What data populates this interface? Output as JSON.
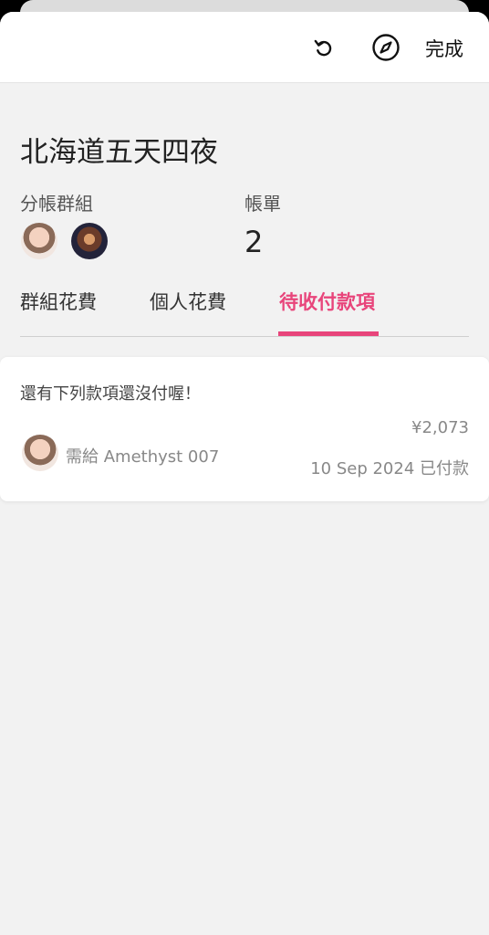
{
  "header": {
    "refresh_icon": "refresh-icon",
    "compass_icon": "compass-icon",
    "done_label": "完成"
  },
  "trip": {
    "title": "北海道五天四夜",
    "group_label": "分帳群組",
    "bills_label": "帳單",
    "bills_count": "2"
  },
  "tabs": [
    {
      "label": "群組花費"
    },
    {
      "label": "個人花費"
    },
    {
      "label": "待收付款項",
      "active": true
    }
  ],
  "pending": {
    "message": "還有下列款項還沒付喔！",
    "items": [
      {
        "text": "需給 Amethyst 007",
        "amount": "¥2,073",
        "status": "10 Sep 2024 已付款"
      }
    ]
  },
  "colors": {
    "accent": "#e8457b",
    "background": "#f2f2f2"
  }
}
